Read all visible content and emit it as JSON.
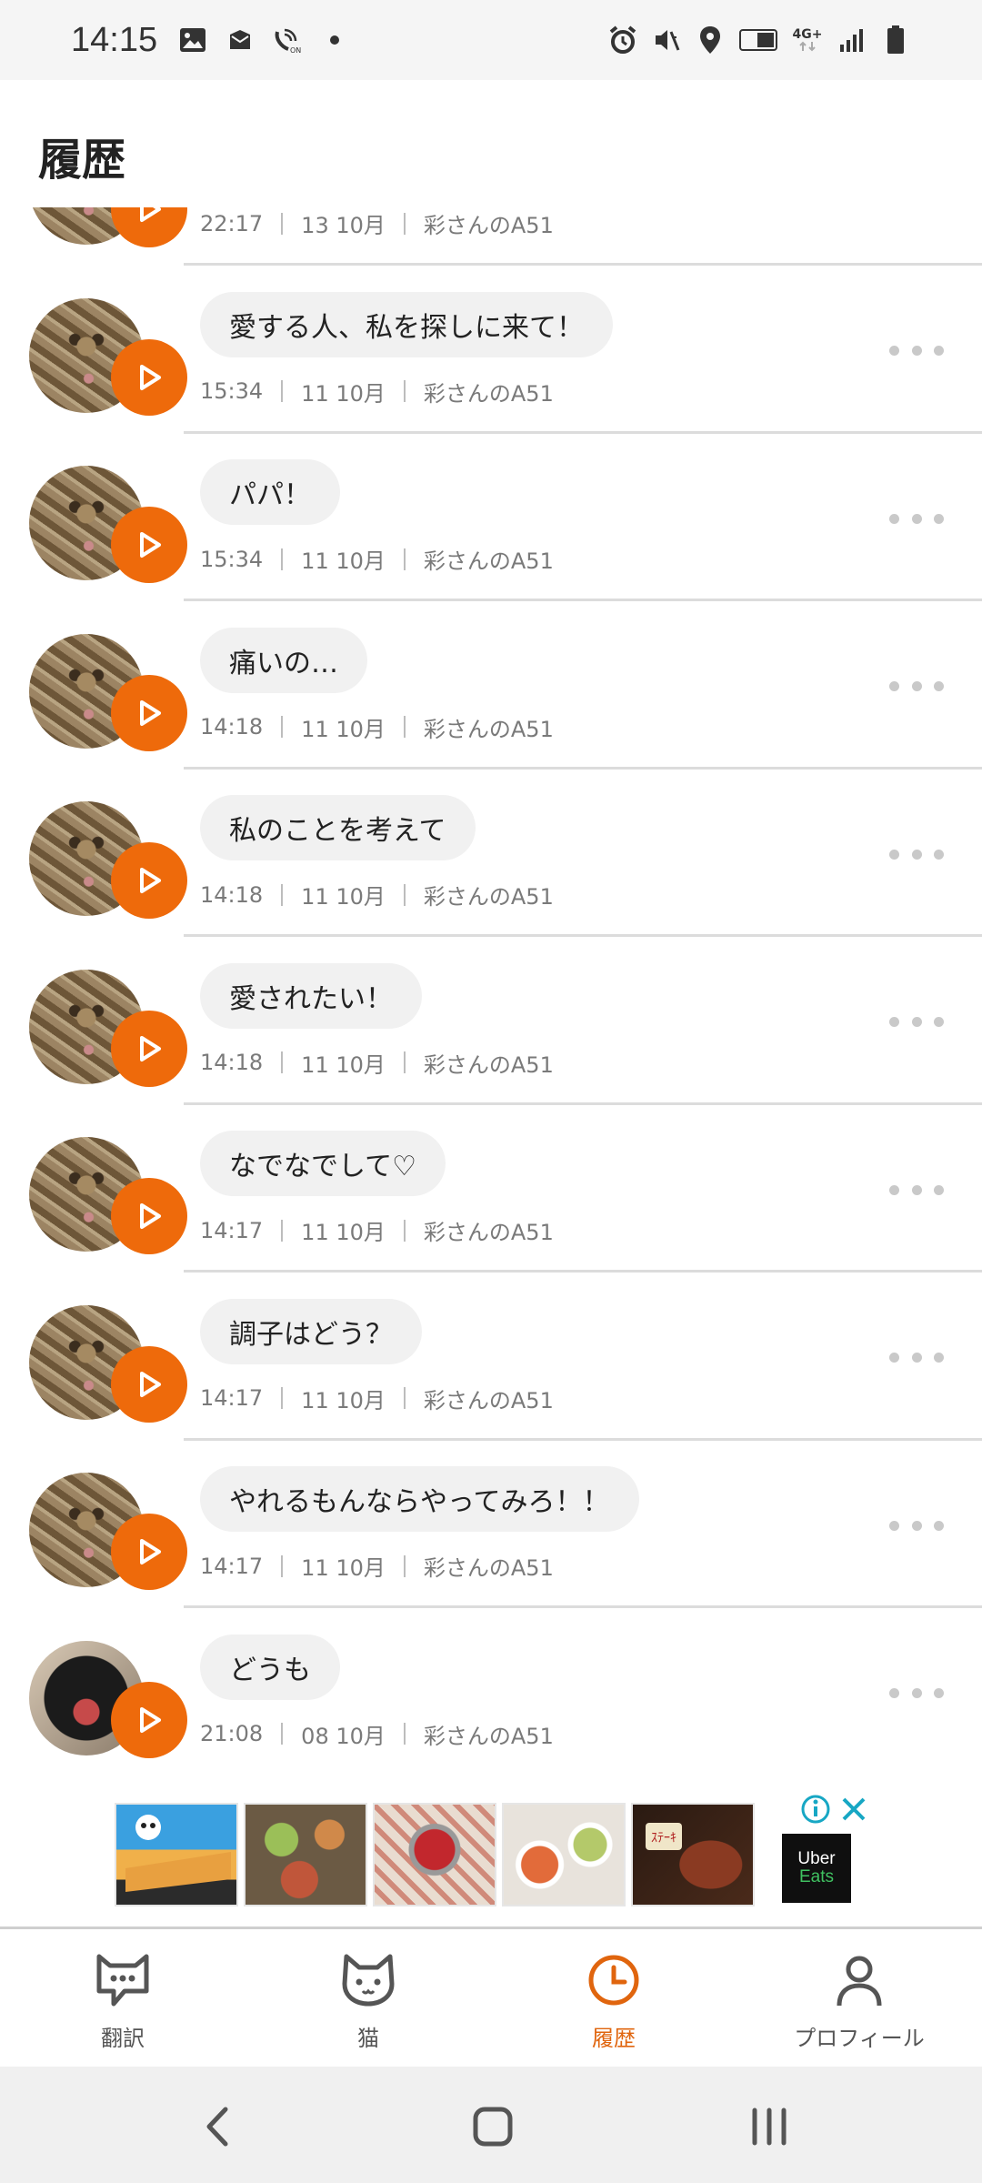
{
  "status_bar": {
    "time": "14:15",
    "left_icons": [
      "image-icon",
      "message-icon",
      "wifi-calling-icon",
      "dot-icon"
    ],
    "right_icons": [
      "alarm-icon",
      "mute-icon",
      "location-icon",
      "volte-icon",
      "4g-icon",
      "signal-icon",
      "battery-icon"
    ],
    "volte_label": "VoLTE",
    "network_label": "4G+"
  },
  "header": {
    "title": "履歴"
  },
  "history": {
    "items": [
      {
        "text": "",
        "time": "22:17",
        "date": "13 10月",
        "device": "彩さんのA51",
        "avatar": "tabby"
      },
      {
        "text": "愛する人、私を探しに来て！",
        "time": "15:34",
        "date": "11 10月",
        "device": "彩さんのA51",
        "avatar": "tabby"
      },
      {
        "text": "パパ！",
        "time": "15:34",
        "date": "11 10月",
        "device": "彩さんのA51",
        "avatar": "tabby"
      },
      {
        "text": "痛いの…",
        "time": "14:18",
        "date": "11 10月",
        "device": "彩さんのA51",
        "avatar": "tabby"
      },
      {
        "text": "私のことを考えて",
        "time": "14:18",
        "date": "11 10月",
        "device": "彩さんのA51",
        "avatar": "tabby"
      },
      {
        "text": "愛されたい！",
        "time": "14:18",
        "date": "11 10月",
        "device": "彩さんのA51",
        "avatar": "tabby"
      },
      {
        "text": "なでなでして♡",
        "time": "14:17",
        "date": "11 10月",
        "device": "彩さんのA51",
        "avatar": "tabby"
      },
      {
        "text": "調子はどう？",
        "time": "14:17",
        "date": "11 10月",
        "device": "彩さんのA51",
        "avatar": "tabby"
      },
      {
        "text": "やれるもんならやってみろ！！",
        "time": "14:17",
        "date": "11 10月",
        "device": "彩さんのA51",
        "avatar": "tabby"
      },
      {
        "text": "どうも",
        "time": "21:08",
        "date": "08 10月",
        "device": "彩さんのA51",
        "avatar": "black"
      }
    ]
  },
  "ad": {
    "brand_line1": "Uber",
    "brand_line2": "Eats",
    "info_icon": "info-icon",
    "close_icon": "close-icon"
  },
  "bottom_nav": {
    "items": [
      {
        "label": "翻訳",
        "icon": "chat-cat-icon",
        "active": false
      },
      {
        "label": "猫",
        "icon": "cat-face-icon",
        "active": false
      },
      {
        "label": "履歴",
        "icon": "clock-icon",
        "active": true
      },
      {
        "label": "プロフィール",
        "icon": "person-icon",
        "active": false
      }
    ]
  },
  "colors": {
    "accent": "#ee6a0b",
    "active_label": "#e0650e",
    "bubble": "#f1f1f1",
    "divider": "#dcdcdc"
  }
}
